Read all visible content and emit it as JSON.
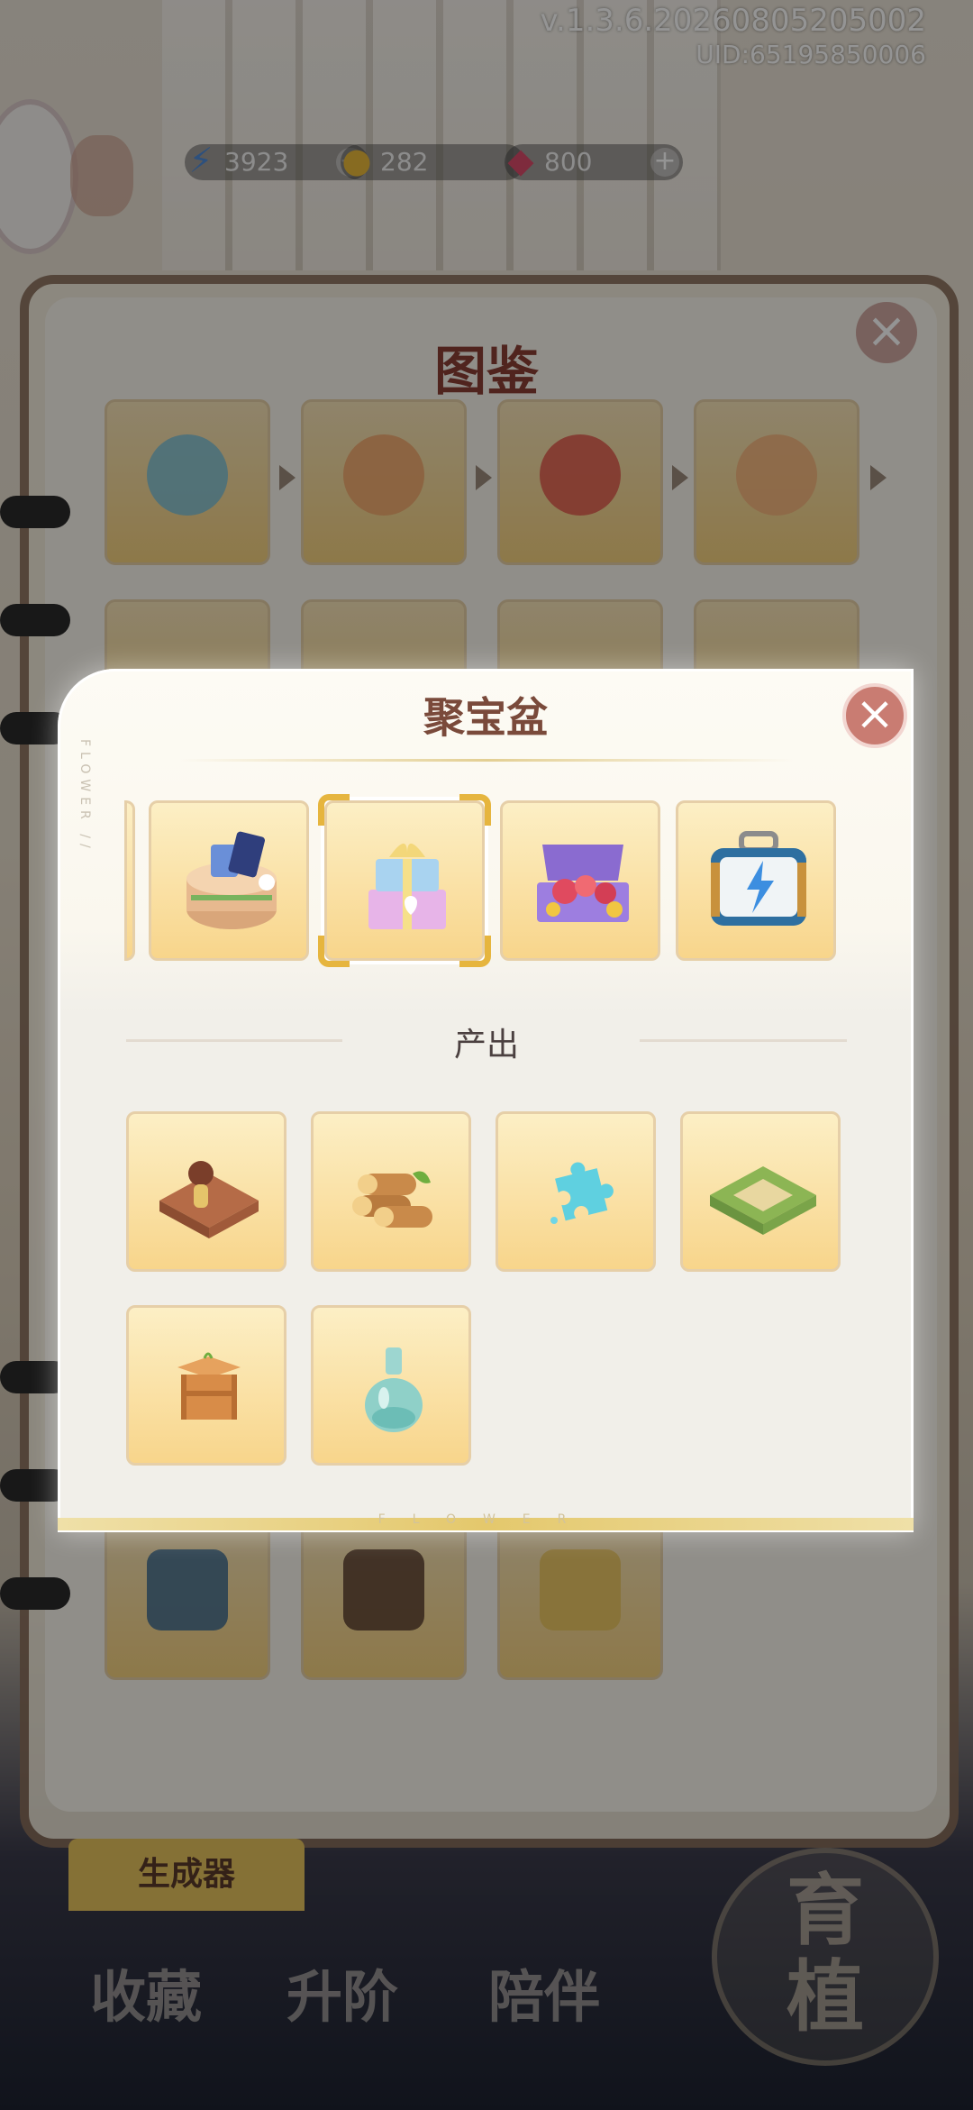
{
  "version": "v.1.3.6.20260805205002",
  "uid": "UID:65195850006",
  "resources": [
    {
      "name": "energy",
      "value": "3923",
      "icon": "lightning-icon"
    },
    {
      "name": "coin",
      "value": "282",
      "icon": "coin-icon"
    },
    {
      "name": "gem",
      "value": "800",
      "icon": "gem-icon"
    }
  ],
  "codex": {
    "title": "图鉴"
  },
  "modal": {
    "title": "聚宝盆",
    "side_text": "FLOWER //",
    "chain_items": [
      "gift-box-with-cards",
      "gift-boxes-stack",
      "treasure-chest",
      "blue-suitcase"
    ],
    "output_label": "产出",
    "outputs": [
      "dressing-doll-tile",
      "wood-logs",
      "crystal-puzzle-piece",
      "grass-tile",
      "wooden-crate",
      "glass-vase"
    ],
    "footer": "FLOWER"
  },
  "generator_tab": "生成器",
  "nav": [
    "收藏",
    "升阶",
    "陪伴",
    "育植"
  ]
}
